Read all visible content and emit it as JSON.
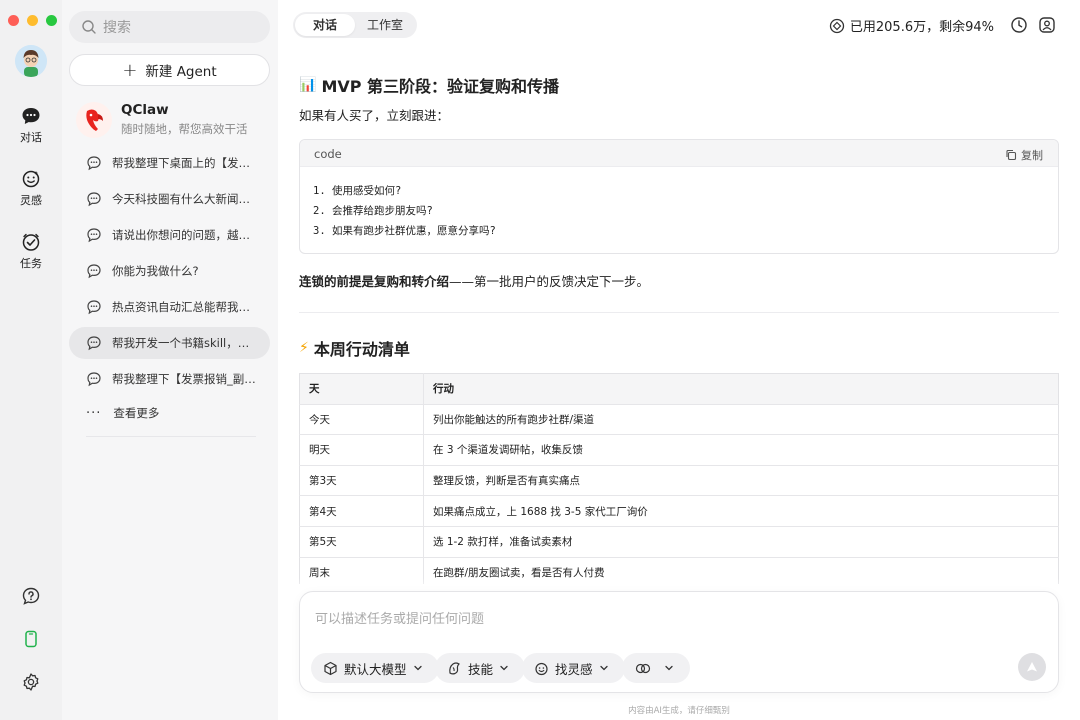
{
  "sidebar": {
    "search_placeholder": "搜索",
    "new_agent_label": "新建 Agent",
    "agent": {
      "name": "QClaw",
      "subtitle": "随时随地，帮您高效干活"
    },
    "conversations": [
      "帮我整理下桌面上的【发票…",
      "今天科技圈有什么大新闻，…",
      "请说出你想问的问题，越具…",
      "你能为我做什么?",
      "热点资讯自动汇总能帮我做…",
      "帮我开发一个书籍skill，能…",
      "帮我整理下【发票报销_副…"
    ],
    "active_index": 5,
    "more_label": "查看更多"
  },
  "rail": {
    "items": [
      {
        "label": "对话",
        "icon": "chat-bubble-icon"
      },
      {
        "label": "灵感",
        "icon": "smile-icon"
      },
      {
        "label": "任务",
        "icon": "check-circle-icon"
      }
    ],
    "bottom_icons": [
      "help-icon",
      "phone-icon",
      "settings-icon"
    ]
  },
  "header": {
    "tabs": [
      "对话",
      "工作室"
    ],
    "active_tab": 0,
    "usage": "已用205.6万，剩余94%"
  },
  "content": {
    "section1_title": "MVP 第三阶段：验证复购和传播",
    "section1_emoji": "📊",
    "followup_intro": "如果有人买了，立刻跟进：",
    "code": {
      "lang": "code",
      "copy_label": "复制",
      "lines": [
        "1. 使用感受如何?",
        "2. 会推荐给跑步朋友吗?",
        "3. 如果有跑步社群优惠，愿意分享吗?"
      ]
    },
    "note_bold": "连锁的前提是复购和转介绍",
    "note_rest": "——第一批用户的反馈决定下一步。",
    "section2_title": "本周行动清单",
    "section2_emoji": "⚡",
    "table": {
      "headers": [
        "天",
        "行动"
      ],
      "rows": [
        [
          "今天",
          "列出你能触达的所有跑步社群/渠道"
        ],
        [
          "明天",
          "在 3 个渠道发调研帖，收集反馈"
        ],
        [
          "第3天",
          "整理反馈，判断是否有真实痛点"
        ],
        [
          "第4天",
          "如果痛点成立，上 1688 找 3-5 家代工厂询价"
        ],
        [
          "第5天",
          "选 1-2 款打样，准备试卖素材"
        ],
        [
          "周末",
          "在跑群/朋友圈试卖，看是否有人付费"
        ]
      ]
    }
  },
  "composer": {
    "placeholder": "可以描述任务或提问任何问题",
    "model_label": "默认大模型",
    "skill_label": "技能",
    "inspire_label": "找灵感"
  },
  "footer": "内容由AI生成，请仔细甄别",
  "colors": {
    "close": "#fe5f57",
    "minimize": "#febc2e",
    "zoom": "#28c840",
    "accent_green": "#21b24c"
  }
}
